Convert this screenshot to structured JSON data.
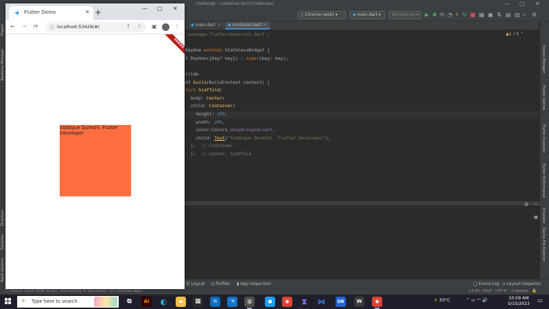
{
  "ide": {
    "title": "challenge – container.dart [challenge]",
    "toolbar": {
      "device_target": "Chrome (web)",
      "run_config": "main.dart",
      "device_selector": "No Devices"
    },
    "tabs": [
      {
        "label": "main.dart",
        "active": false
      },
      {
        "label": "container.dart",
        "active": true
      }
    ],
    "code_lines": [
      {
        "segments": [
          {
            "t": "'package:flutter/material.dart'",
            "c": "str"
          },
          {
            "t": ";",
            "c": ""
          }
        ]
      },
      {
        "segments": []
      },
      {
        "segments": [
          {
            "t": "DayOne ",
            "c": ""
          },
          {
            "t": "extends ",
            "c": "kw"
          },
          {
            "t": "StatelessWidget {",
            "c": ""
          }
        ]
      },
      {
        "segments": [
          {
            "t": "t DayOne({Key? key}) : ",
            "c": ""
          },
          {
            "t": "super",
            "c": "kw"
          },
          {
            "t": "(key: key);",
            "c": ""
          }
        ]
      },
      {
        "segments": []
      },
      {
        "segments": [
          {
            "t": "rride",
            "c": ""
          }
        ]
      },
      {
        "segments": [
          {
            "t": "et ",
            "c": ""
          },
          {
            "t": "build",
            "c": "fn"
          },
          {
            "t": "(BuildContext context) {",
            "c": ""
          }
        ]
      },
      {
        "segments": [
          {
            "t": "turn ",
            "c": "kw"
          },
          {
            "t": "Scaffold",
            "c": "cls"
          },
          {
            "t": "(",
            "c": ""
          }
        ]
      },
      {
        "segments": [
          {
            "t": "  body: ",
            "c": ""
          },
          {
            "t": "Center",
            "c": "cls"
          },
          {
            "t": "(",
            "c": ""
          }
        ]
      },
      {
        "segments": [
          {
            "t": "  child: ",
            "c": ""
          },
          {
            "t": "Container",
            "c": "cls"
          },
          {
            "t": "(",
            "c": ""
          }
        ]
      },
      {
        "segments": [
          {
            "t": "    height: ",
            "c": ""
          },
          {
            "t": "200",
            "c": "num"
          },
          {
            "t": ",",
            "c": ""
          }
        ],
        "highlight": true
      },
      {
        "segments": [
          {
            "t": "    width: ",
            "c": ""
          },
          {
            "t": "200",
            "c": "num"
          },
          {
            "t": ",",
            "c": ""
          }
        ]
      },
      {
        "segments": [
          {
            "t": "    color:Colors.",
            "c": ""
          },
          {
            "t": "deepOrangeAccent",
            "c": "ital"
          },
          {
            "t": ",",
            "c": ""
          }
        ]
      },
      {
        "segments": [
          {
            "t": "    child: ",
            "c": ""
          },
          {
            "t": "Text",
            "c": "und"
          },
          {
            "t": "(",
            "c": ""
          },
          {
            "t": "\"Siddique Qureshi, Flutter Developer\"",
            "c": "str"
          },
          {
            "t": "),",
            "c": ""
          }
        ]
      },
      {
        "segments": [
          {
            "t": "  ),  ",
            "c": ""
          },
          {
            "t": "// Container",
            "c": "cm"
          }
        ]
      },
      {
        "segments": [
          {
            "t": "  );  ",
            "c": ""
          },
          {
            "t": "// Center, Scaffold",
            "c": "cm"
          }
        ]
      }
    ],
    "inspection": {
      "warnings": "1",
      "checks": "1"
    },
    "right_tools": [
      "Device Manager",
      "Flutter Outline",
      "Flutter Inspector",
      "Flutter Performance",
      "Emulator",
      "Device File Explorer"
    ],
    "left_tools": [
      "Project",
      "Resource Manager",
      "Structure",
      "Favorites",
      "Build Variants"
    ],
    "bottom_tabs": [
      "Logcat",
      "Profiler",
      "App Inspection",
      "Event Log",
      "Layout Inspector"
    ],
    "status": {
      "message": "Cannot reach ADB server, attempting to reconnect. (21 minutes ago)",
      "position": "11:20",
      "line_sep": "CRLF",
      "encoding": "UTF-8",
      "indent": "2 spaces"
    }
  },
  "browser": {
    "tab_title": "Flutter Demo",
    "url": "localhost:53429/#/",
    "debug_banner": "DEBUG",
    "app_text": "Siddique Qureshi, Flutter Developer",
    "box_color": "#ff6e40"
  },
  "taskbar": {
    "search_placeholder": "Type here to search",
    "weather": "33°C",
    "time": "10:59 AM",
    "date": "5/15/2023"
  }
}
